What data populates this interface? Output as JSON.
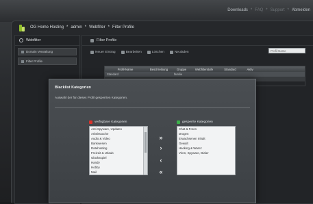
{
  "topnav": {
    "downloads": "Downloads",
    "sep": "*",
    "faq": "FAQ",
    "support": "Support",
    "logout": "Abmelden"
  },
  "window": {
    "breadcrumb": [
      "OG Home Hosting",
      "admin",
      "Webfilter",
      "Filter Profile"
    ],
    "breadcrumb_sep": "*"
  },
  "sidebar": {
    "title": "Webfilter",
    "items": [
      {
        "label": "Domain Verwaltung"
      },
      {
        "label": "Filter Profile"
      }
    ]
  },
  "content": {
    "title": "Filter Profile",
    "toolbar": {
      "new": "Neuer Eintrag",
      "edit": "Bearbeiten",
      "delete": "Löschen",
      "reload": "Neuladen"
    },
    "search_placeholder": "Profil-Name",
    "grid": {
      "columns": [
        "Profil-Name",
        "Beschreibung",
        "Gruppe",
        "Webfilterstufe",
        "Standard",
        "Aktiv"
      ],
      "rows": [
        [
          "Standard",
          "",
          "familie",
          "",
          "",
          ""
        ],
        [
          "",
          "",
          "",
          "",
          "",
          ""
        ]
      ]
    }
  },
  "modal": {
    "title": "Blacklist Kategorien",
    "description": "Auswahl der für dieses Profil gesperrten Kategorien.",
    "available_label": "verfügbare Kategorien",
    "blocked_label": "gesperrte Kategorien",
    "available": [
      "Anti-Spyware, Updates",
      "Arbeitssuche",
      "Audio & Video",
      "Bankwesen",
      "Datehosting",
      "Freizeit & Urlaub",
      "Glücksspiel",
      "Handy",
      "Hobby",
      "Mail"
    ],
    "blocked": [
      "Chat & Foren",
      "Drogen",
      "Erwachsenen Inhalt",
      "Gewalt",
      "Hacking & Warez",
      "Viren, Spyware, Dialer"
    ],
    "buttons": {
      "add_all": "»",
      "add": "›",
      "remove": "‹",
      "remove_all": "«"
    },
    "colors": {
      "available_dot": "#d9322b",
      "blocked_dot": "#3bb04a"
    }
  }
}
